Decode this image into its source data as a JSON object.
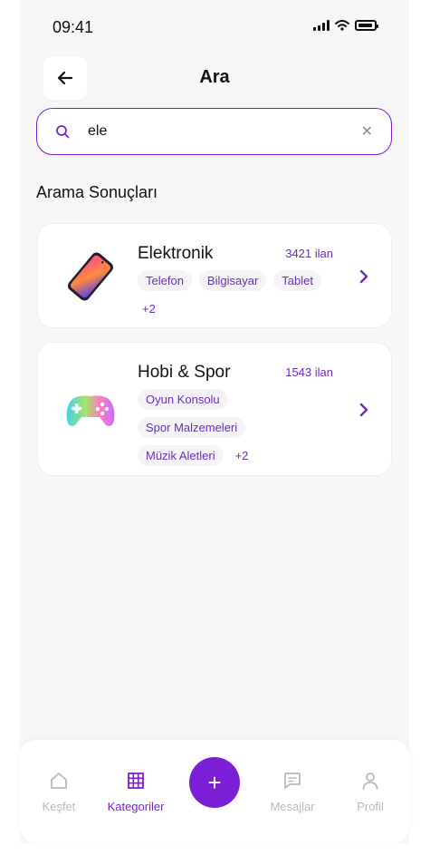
{
  "status_bar": {
    "time": "09:41"
  },
  "header": {
    "title": "Ara"
  },
  "search": {
    "value": "ele"
  },
  "results": {
    "title": "Arama Sonuçları",
    "items": [
      {
        "name": "Elektronik",
        "count": "3421 ilan",
        "tags": [
          "Telefon",
          "Bilgisayar",
          "Tablet"
        ],
        "more": "+2",
        "icon": "phone-icon"
      },
      {
        "name": "Hobi & Spor",
        "count": "1543 ilan",
        "tags": [
          "Oyun Konsolu",
          "Spor Malzemeleri",
          "Müzik Aletleri"
        ],
        "more": "+2",
        "icon": "gamepad-icon"
      }
    ]
  },
  "tabbar": {
    "items": [
      {
        "label": "Keşfet",
        "icon": "home-icon"
      },
      {
        "label": "Kategoriler",
        "icon": "grid-icon",
        "active": true
      },
      {
        "label": "Mesajlar",
        "icon": "message-icon"
      },
      {
        "label": "Profil",
        "icon": "user-icon"
      }
    ],
    "fab": "+"
  },
  "colors": {
    "accent": "#7a1fd6",
    "tag_text": "#6a2bbf",
    "background": "#f7f7f8"
  }
}
